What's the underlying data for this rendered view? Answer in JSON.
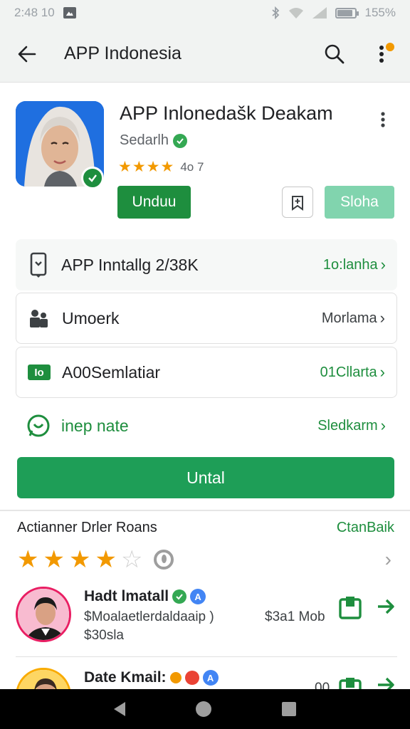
{
  "status_bar": {
    "time": "2:48 10",
    "battery_text": "155%",
    "battery_level": 0.9
  },
  "app_bar": {
    "title": "APP Indonesia"
  },
  "app": {
    "name": "APP Inlonedašk Deakam",
    "developer": "Sedarlh",
    "rating_text": "4o 7",
    "stars": 4,
    "install_label": "Unduu",
    "share_label": "Sloha"
  },
  "info_rows": [
    {
      "label": "APP Inntallg 2/38K",
      "value": "1o:lanha",
      "icon": "phone-download-icon"
    },
    {
      "label": "Umoerk",
      "value": "Morlama",
      "icon": "people-icon"
    },
    {
      "label": "A00Semlatiar",
      "value": "01Cllarta",
      "icon": "io-badge-icon",
      "icon_text": "Io"
    },
    {
      "label": "inep nate",
      "value": "Sledkarm",
      "icon": "whatsapp-icon"
    }
  ],
  "main_button": {
    "label": "Untal"
  },
  "reviews": {
    "title": "Actianner Drler Roans",
    "link": "CtanBaik",
    "stars": 4,
    "items": [
      {
        "name": "Hadt lmatall",
        "sub1": "$Moalaetlerdaldaaip )",
        "sub2": "$30sla",
        "price": "$3a1 Mob"
      },
      {
        "name": "Date Kmail:",
        "sub1": "",
        "sub2": "",
        "price": "00"
      }
    ]
  },
  "colors": {
    "accent": "#1e8e3e",
    "star": "#f29900",
    "share_button": "#81d4ae"
  }
}
